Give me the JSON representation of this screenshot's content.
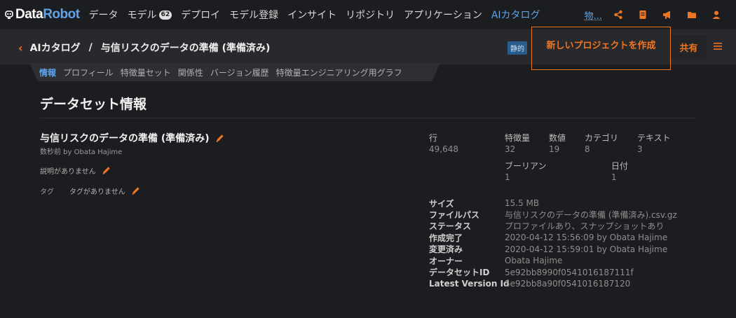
{
  "nav": {
    "brand_data": "Data",
    "brand_robot": "Robot",
    "items": [
      {
        "label": "データ"
      },
      {
        "label": "モデル",
        "badge": "62"
      },
      {
        "label": "デプロイ"
      },
      {
        "label": "モデル登録"
      },
      {
        "label": "インサイト"
      },
      {
        "label": "リポジトリ"
      },
      {
        "label": "アプリケーション"
      },
      {
        "label": "AIカタログ"
      }
    ],
    "more": "物...",
    "icons": [
      "share-icon",
      "notebook-icon",
      "megaphone-icon",
      "folder-icon",
      "user-icon"
    ],
    "accent": "#5ea4e6"
  },
  "header": {
    "back_label": "AIカタログ",
    "separator": "/",
    "title": "与信リスクのデータの準備 (準備済み)",
    "static_badge": "静的",
    "create_button": "新しいプロジェクトを作成",
    "share_button": "共有",
    "accent": "#ee7623"
  },
  "tabs": [
    "情報",
    "プロフィール",
    "特徴量セット",
    "関係性",
    "バージョン履歴",
    "特徴量エンジニアリング用グラフ"
  ],
  "info": {
    "section_title": "データセット情報",
    "dataset_name": "与信リスクのデータの準備 (準備済み)",
    "created_by": "数秒前 by Obata Hajime",
    "description": "説明がありません",
    "tags_label": "タグ",
    "tags_value": "タグがありません"
  },
  "stats": {
    "rows_label": "行",
    "rows_value": "49,648",
    "features_label": "特徴量",
    "features_value": "32",
    "numeric_label": "数値",
    "numeric_value": "19",
    "category_label": "カテゴリ",
    "category_value": "8",
    "text_label": "テキスト",
    "text_value": "3",
    "boolean_label": "ブーリアン",
    "boolean_value": "1",
    "date_label": "日付",
    "date_value": "1"
  },
  "meta": [
    {
      "key": "サイズ",
      "value": "15.5 MB"
    },
    {
      "key": "ファイルパス",
      "value": "与信リスクのデータの準備 (準備済み).csv.gz"
    },
    {
      "key": "ステータス",
      "value": "プロファイルあり、スナップショットあり"
    },
    {
      "key": "作成完了",
      "value": "2020-04-12 15:56:09 by Obata Hajime"
    },
    {
      "key": "変更済み",
      "value": "2020-04-12 15:59:01 by Obata Hajime"
    },
    {
      "key": "オーナー",
      "value": "Obata Hajime"
    },
    {
      "key": "データセットID",
      "value": "5e92bb8990f0541016187111f"
    },
    {
      "key": "Latest Version Id",
      "value": "5e92bb8a90f0541016187120"
    }
  ]
}
